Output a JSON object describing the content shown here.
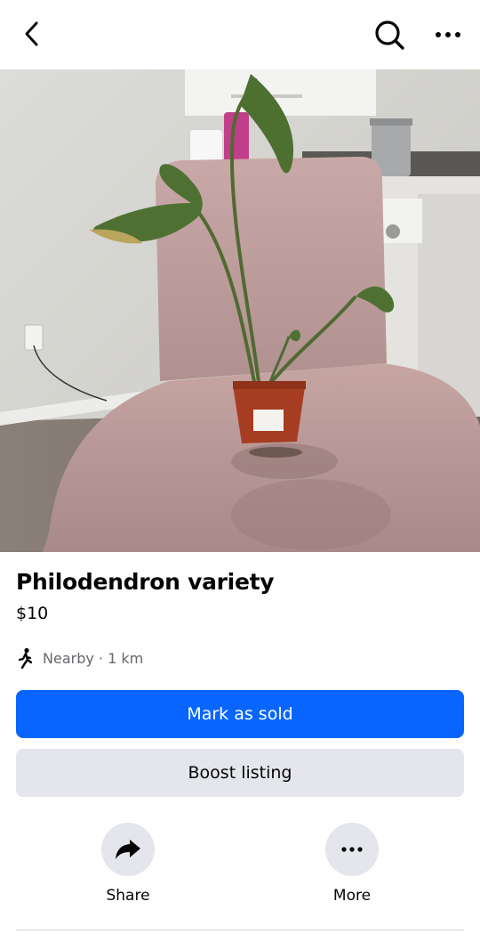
{
  "topbar": {
    "back_icon": "chevron-left-icon",
    "search_icon": "search-icon",
    "more_icon": "ellipsis-icon"
  },
  "listing": {
    "title": "Philodendron variety",
    "price": "$10",
    "location": "Nearby · 1 km",
    "location_icon": "walking-person-icon"
  },
  "buttons": {
    "mark_sold": "Mark as sold",
    "boost": "Boost listing"
  },
  "actions": [
    {
      "label": "Share",
      "icon": "share-arrow-icon"
    },
    {
      "label": "More",
      "icon": "ellipsis-icon"
    }
  ],
  "colors": {
    "primary": "#0866ff",
    "secondary_bg": "#e4e6eb",
    "muted_text": "#65676b"
  }
}
